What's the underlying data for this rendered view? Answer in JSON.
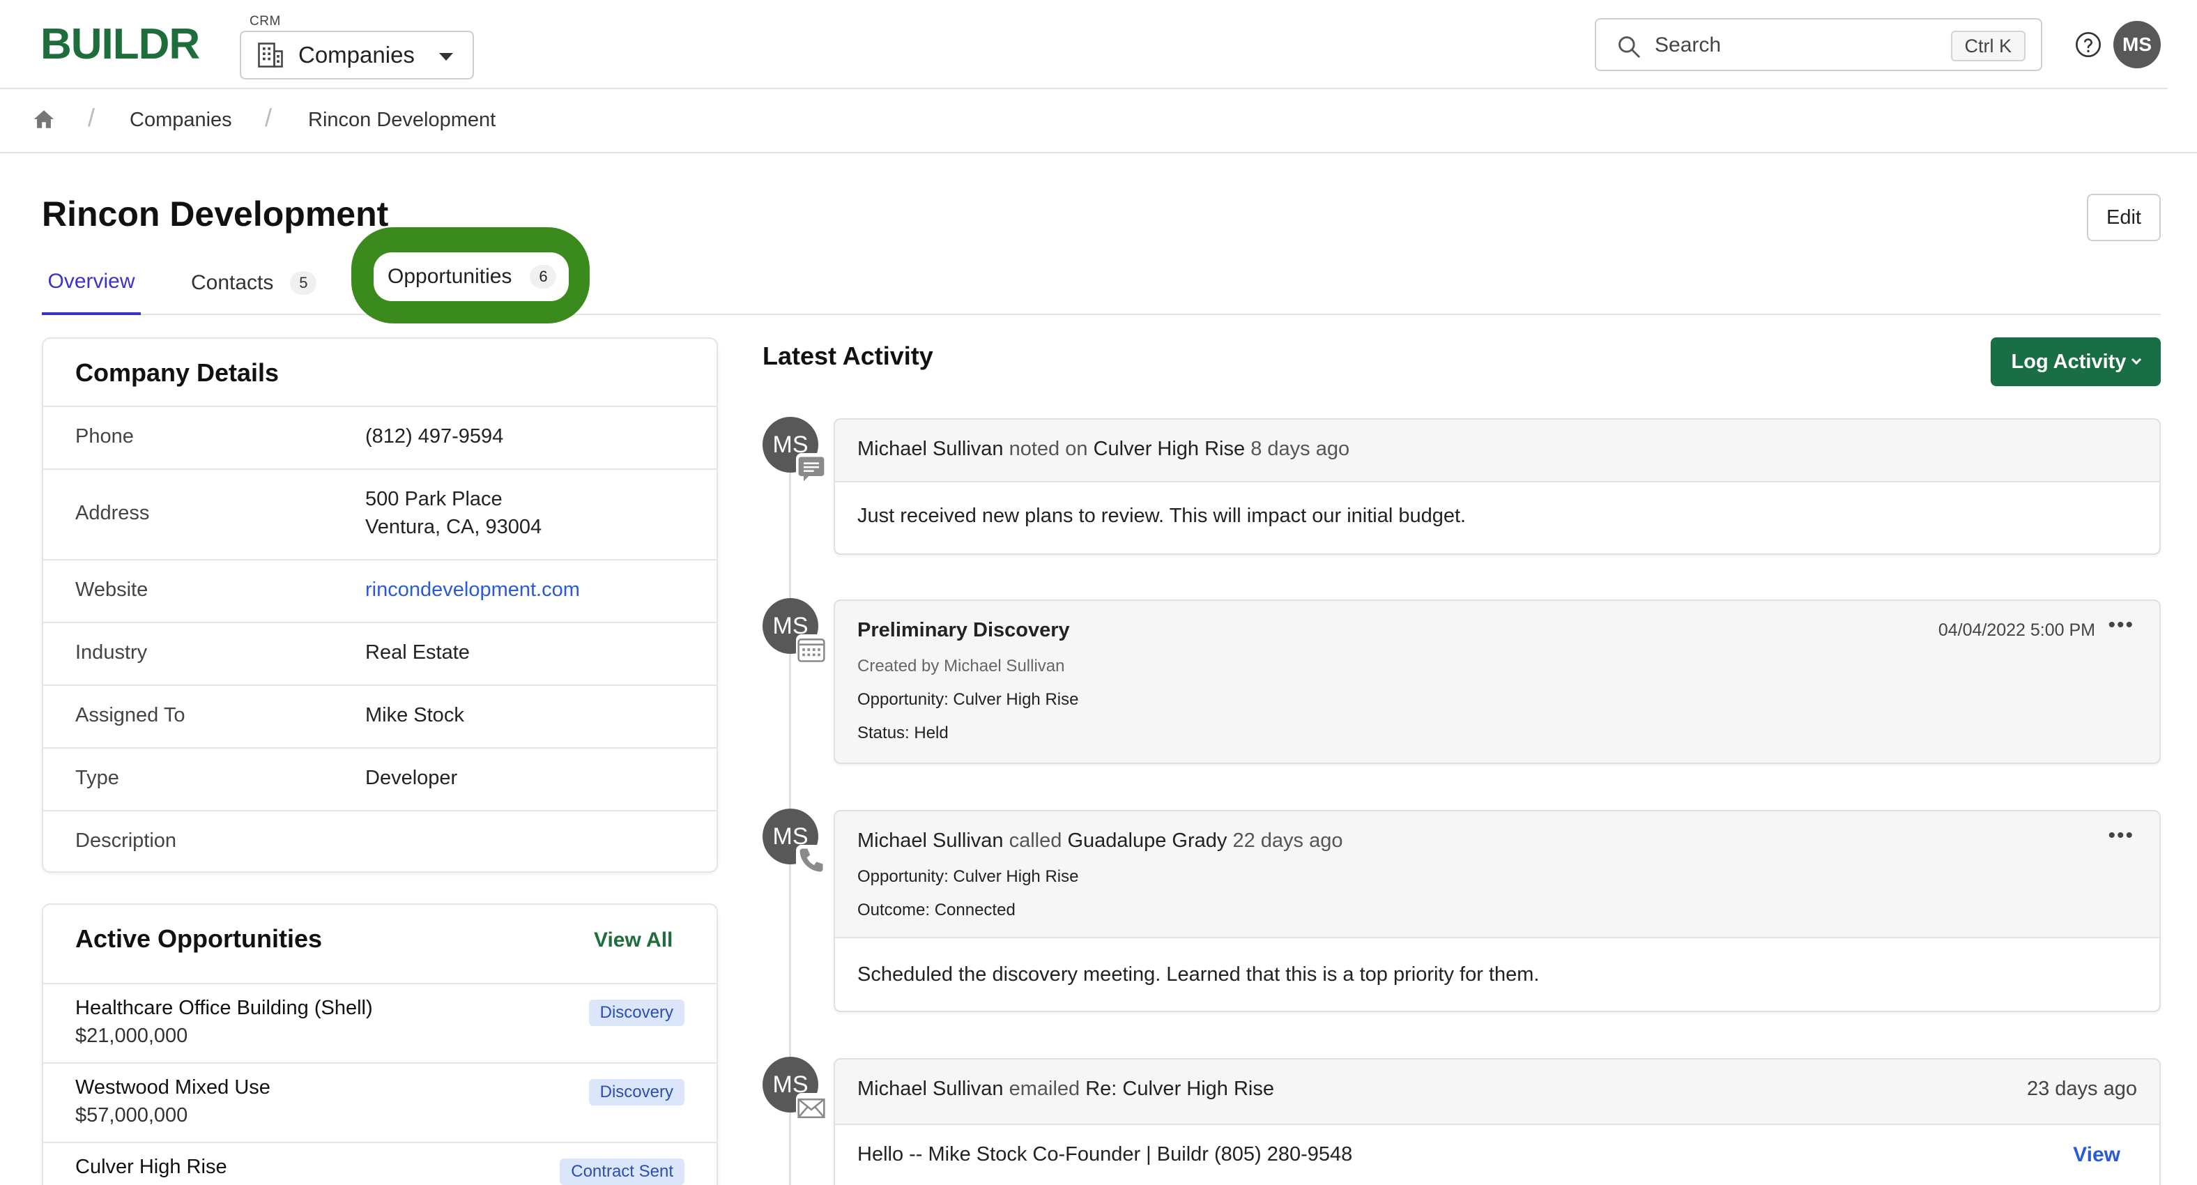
{
  "app": {
    "logo": "BUILDR",
    "module_label": "CRM",
    "module": "Companies",
    "search_placeholder": "Search",
    "search_shortcut": "Ctrl K",
    "user_initials": "MS"
  },
  "breadcrumb": [
    "Companies",
    "Rincon Development"
  ],
  "page": {
    "title": "Rincon Development",
    "edit_label": "Edit"
  },
  "tabs": [
    {
      "label": "Overview",
      "count": ""
    },
    {
      "label": "Contacts",
      "count": "5"
    },
    {
      "label": "Opportunities",
      "count": "6"
    }
  ],
  "company_details": {
    "title": "Company Details",
    "rows": [
      {
        "key": "Phone",
        "value": "(812) 497-9594"
      },
      {
        "key": "Address",
        "value": "500 Park Place",
        "value2": "Ventura, CA, 93004"
      },
      {
        "key": "Website",
        "value": "rincondevelopment.com"
      },
      {
        "key": "Industry",
        "value": "Real Estate"
      },
      {
        "key": "Assigned To",
        "value": "Mike Stock"
      },
      {
        "key": "Type",
        "value": "Developer"
      },
      {
        "key": "Description",
        "value": ""
      }
    ]
  },
  "active_opportunities": {
    "title": "Active Opportunities",
    "view_all": "View All",
    "items": [
      {
        "name": "Healthcare Office Building (Shell)",
        "amount": "$21,000,000",
        "stage": "Discovery"
      },
      {
        "name": "Westwood Mixed Use",
        "amount": "$57,000,000",
        "stage": "Discovery"
      },
      {
        "name": "Culver High Rise",
        "amount": "",
        "stage": "Contract Sent"
      }
    ]
  },
  "activity": {
    "title": "Latest Activity",
    "log_label": "Log Activity",
    "items": [
      {
        "initials": "MS",
        "actor": "Michael Sullivan",
        "verb": "noted on",
        "target": "Culver High Rise",
        "when": "8 days ago",
        "body": "Just received new plans to review. This will impact our initial budget."
      },
      {
        "initials": "MS",
        "title": "Preliminary Discovery",
        "created_by": "Created by Michael Sullivan",
        "opportunity": "Opportunity: Culver High Rise",
        "status": "Status: Held",
        "date": "04/04/2022 5:00 PM"
      },
      {
        "initials": "MS",
        "actor": "Michael Sullivan",
        "verb": "called",
        "target": "Guadalupe Grady",
        "when": "22 days ago",
        "opportunity": "Opportunity: Culver High Rise",
        "outcome": "Outcome: Connected",
        "body": "Scheduled the discovery meeting. Learned that this is a top priority for them."
      },
      {
        "initials": "MS",
        "actor": "Michael Sullivan",
        "verb": "emailed",
        "subject": "Re: Culver High Rise",
        "when": "23 days ago",
        "body": "Hello -- Mike Stock Co-Founder | Buildr (805) 280-9548",
        "view_label": "View"
      }
    ]
  },
  "icons": {
    "home": "home-icon",
    "building": "building-icon",
    "search": "search-icon",
    "help": "help-circle-icon",
    "note": "note-icon",
    "calendar": "calendar-icon",
    "phone": "phone-icon",
    "email": "envelope-icon"
  },
  "colors": {
    "brand": "#1e6e3c",
    "primary_button": "#1a6e45",
    "active_tab": "#3b33c8",
    "link": "#2a5bd7",
    "highlight": "#3a8a1e",
    "badge_bg": "#dbe6fb"
  }
}
